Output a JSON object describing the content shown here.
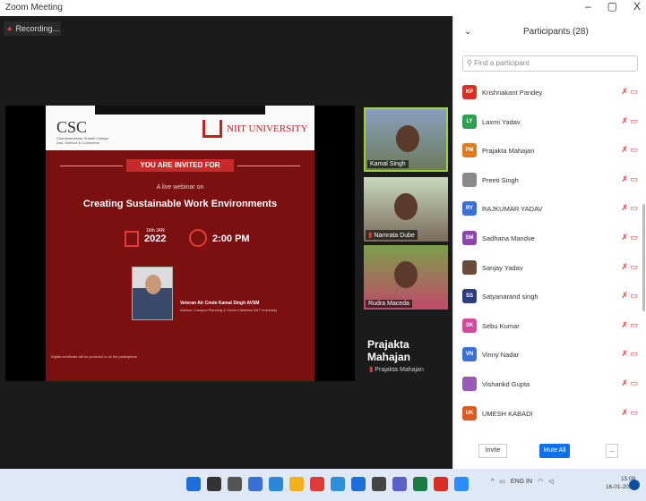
{
  "window": {
    "title": "Zoom Meeting",
    "minimize": "–",
    "maximize": "▢",
    "close": "X"
  },
  "recording": {
    "label": "Recording..."
  },
  "slide": {
    "csc": "CSC",
    "csc_sub": "Chandrashekhar Shastri College Arts, Science & Commerce",
    "niit": "NIIT UNIVERSITY",
    "invited": "YOU ARE INVITED FOR",
    "live": "A live webinar on",
    "title": "Creating Sustainable Work Environments",
    "date_day": "16th JAN",
    "date_year": "2022",
    "time": "2:00 PM",
    "speaker": "Veteran Air Cmde Kamal Singh AVSM",
    "role": "Advisor: Campus Planning & Green Initiatives NIIT University",
    "cert": "Digital certificate will be provided to all the participants"
  },
  "thumbs": [
    {
      "name": "Kamal Singh"
    },
    {
      "name": "Namrata Dube"
    },
    {
      "name": "Rudra Maceda"
    }
  ],
  "active_speaker": {
    "name": "Prajakta Mahajan",
    "sub": "Prajakta Mahajan"
  },
  "panel": {
    "chevron": "⌄",
    "title": "Participants (28)",
    "search_placeholder": "Find a participant",
    "participants": [
      {
        "initials": "KP",
        "name": "Krishnakant Pandey",
        "color": "#d93025"
      },
      {
        "initials": "LY",
        "name": "Laxmi Yadav",
        "color": "#2e9e4f"
      },
      {
        "initials": "PM",
        "name": "Prajakta Mahajan",
        "color": "#e07a1f"
      },
      {
        "initials": "",
        "name": "Preeti Singh",
        "color": "#8a8a8a"
      },
      {
        "initials": "RY",
        "name": "RAJKUMAR YADAV",
        "color": "#3a6fd8"
      },
      {
        "initials": "SM",
        "name": "Sadhana Mandve",
        "color": "#8e44ad"
      },
      {
        "initials": "",
        "name": "Sanjay Yadav",
        "color": "#6b4b3b"
      },
      {
        "initials": "SS",
        "name": "Satyanarand singh",
        "color": "#2c3e7a"
      },
      {
        "initials": "SK",
        "name": "Sebu Kumar",
        "color": "#d946a0"
      },
      {
        "initials": "VN",
        "name": "Vinny Nadar",
        "color": "#3a6fd8"
      },
      {
        "initials": "",
        "name": "Vishankd Gupta",
        "color": "#9b59b6"
      },
      {
        "initials": "UK",
        "name": "UMESH KABADI",
        "color": "#e05a1f"
      }
    ],
    "invite": "Invite",
    "mute_all": "Mute All",
    "more": "..."
  },
  "taskbar": {
    "icons": [
      "start-icon",
      "search-icon",
      "taskview-icon",
      "files-icon",
      "store-icon",
      "explorer-icon",
      "chrome-icon",
      "edge-icon",
      "mail-icon",
      "sigma-icon",
      "teams-icon",
      "excel-icon",
      "g-icon",
      "zoom-icon"
    ],
    "lang": "ENG IN",
    "time": "15:08",
    "date": "16-01-2022"
  }
}
